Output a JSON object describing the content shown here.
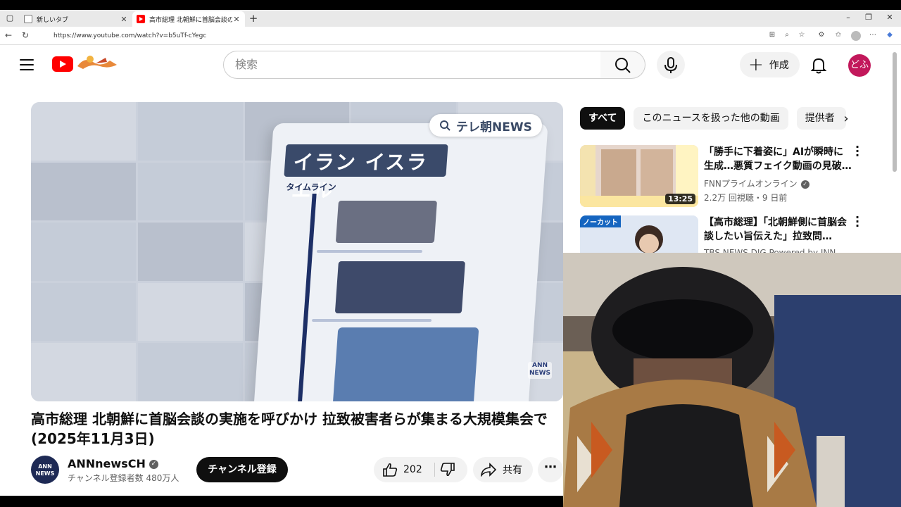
{
  "browser": {
    "tabs": [
      {
        "title": "新しいタブ",
        "active": false
      },
      {
        "title": "高市総理 北朝鮮に首脳会談の実施",
        "active": true
      }
    ],
    "new_tab_icon": "plus-icon",
    "url": "https://www.youtube.com/watch?v=b5uTf-cYegc"
  },
  "youtube": {
    "search_placeholder": "検索",
    "create_label": "作成",
    "avatar_label": "どふ",
    "video": {
      "title": "高市総理 北朝鮮に首脳会談の実施を呼びかけ 拉致被害者らが集まる大規模集会で(2025年11月3日)",
      "overlay_badge": "テレ朝NEWS",
      "tablet_heading": "イラン イスラエル",
      "tablet_timeline": "タイムライン",
      "corner_logo_line1": "ANN",
      "corner_logo_line2": "NEWS"
    },
    "channel": {
      "name": "ANNnewsCH",
      "subscribers": "チャンネル登録者数 480万人",
      "avatar_line1": "ANN",
      "avatar_line2": "NEWS",
      "subscribe_label": "チャンネル登録"
    },
    "actions": {
      "likes": "202",
      "share_label": "共有"
    },
    "chips": [
      "すべて",
      "このニュースを扱った他の動画",
      "提供者"
    ],
    "recommendations": [
      {
        "title": "「勝手に下着姿に」AIが瞬時に生成…悪質フェイク動画の見破…",
        "channel": "FNNプライムオンライン",
        "meta": "2.2万 回視聴・9 日前",
        "duration": "13:25",
        "badge": ""
      },
      {
        "title": "【高市総理】「北朝鮮側に首脳会談したい旨伝えた」拉致問…",
        "channel": "TBS NEWS DIG Powered by JNN",
        "meta": "",
        "duration": "",
        "badge": "ノーカット"
      }
    ]
  },
  "colors": {
    "yt_red": "#ff0000",
    "avatar_bg": "#c2185b",
    "chip_active_bg": "#0f0f0f"
  }
}
